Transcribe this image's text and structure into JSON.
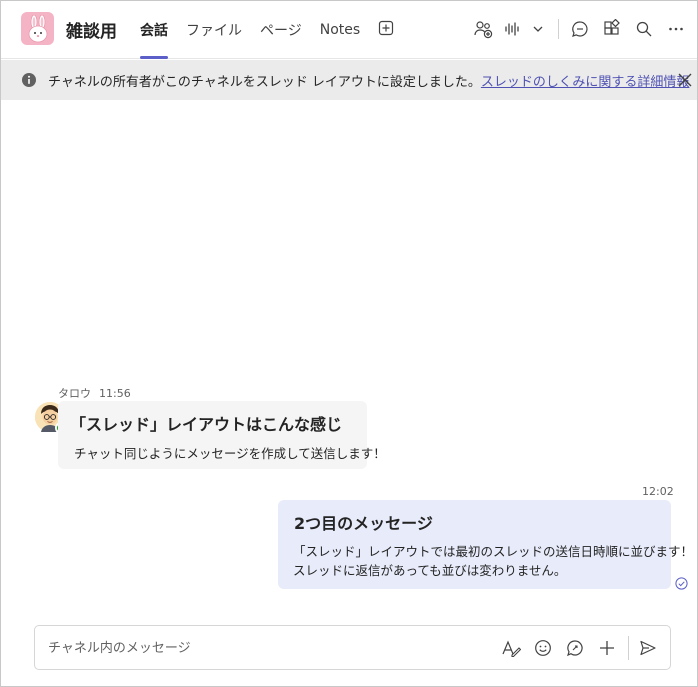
{
  "header": {
    "channel_title": "雑談用",
    "team_avatar_icon": "rabbit-icon",
    "tabs": [
      {
        "label": "会話",
        "active": true
      },
      {
        "label": "ファイル",
        "active": false
      },
      {
        "label": "ページ",
        "active": false
      },
      {
        "label": "Notes",
        "active": false
      }
    ],
    "icons": [
      "add-tab-icon",
      "people-add-icon",
      "meet-audio-icon",
      "chevron-down-icon",
      "chat-icon",
      "apps-icon",
      "search-icon",
      "more-icon"
    ]
  },
  "banner": {
    "text": "チャネルの所有者がこのチャネルをスレッド レイアウトに設定しました。",
    "link": "スレッドのしくみに関する詳細情報"
  },
  "messages": [
    {
      "author": "タロウ",
      "time": "11:56",
      "subject": "「スレッド」レイアウトはこんな感じ",
      "body": "チャット同じようにメッセージを作成して送信します！"
    },
    {
      "time": "12:02",
      "subject": "2つ目のメッセージ",
      "body_line1": "「スレッド」レイアウトでは最初のスレッドの送信日時順に並びます！",
      "body_line2": "スレッドに返信があっても並びは変わりません。"
    }
  ],
  "compose": {
    "placeholder": "チャネル内のメッセージ"
  },
  "colors": {
    "accent": "#5b5fc7",
    "link": "#4f52b2",
    "banner_bg": "#ebebeb",
    "own_bubble": "#e8ebfa",
    "other_bubble": "#f5f5f5",
    "presence": "#13a10e"
  }
}
